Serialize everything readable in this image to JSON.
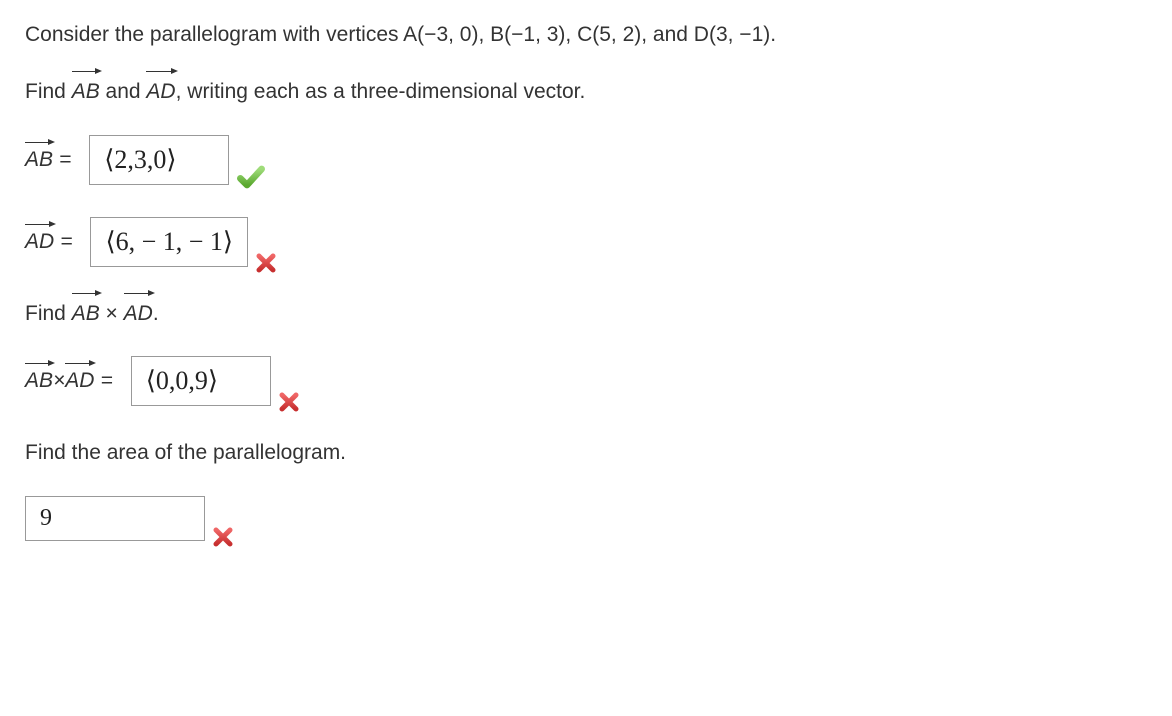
{
  "problem": {
    "statement": "Consider the parallelogram with vertices A(−3, 0), B(−1, 3), C(5, 2), and D(3, −1).",
    "instruction1_prefix": "Find ",
    "instruction1_mid": " and ",
    "instruction1_suffix": ", writing each as a three-dimensional vector.",
    "vec_ab": "AB",
    "vec_ad": "AD",
    "instruction2_prefix": "Find ",
    "instruction2_mid": " × ",
    "instruction2_suffix": ".",
    "instruction3": "Find the area of the parallelogram.",
    "cross_label_mid": " × ",
    "equals": "="
  },
  "answers": {
    "ab": "⟨2,3,0⟩",
    "ad": "⟨6, − 1, − 1⟩",
    "cross": "⟨0,0,9⟩",
    "area": "9"
  },
  "feedback": {
    "ab": "correct",
    "ad": "incorrect",
    "cross": "incorrect",
    "area": "incorrect"
  }
}
